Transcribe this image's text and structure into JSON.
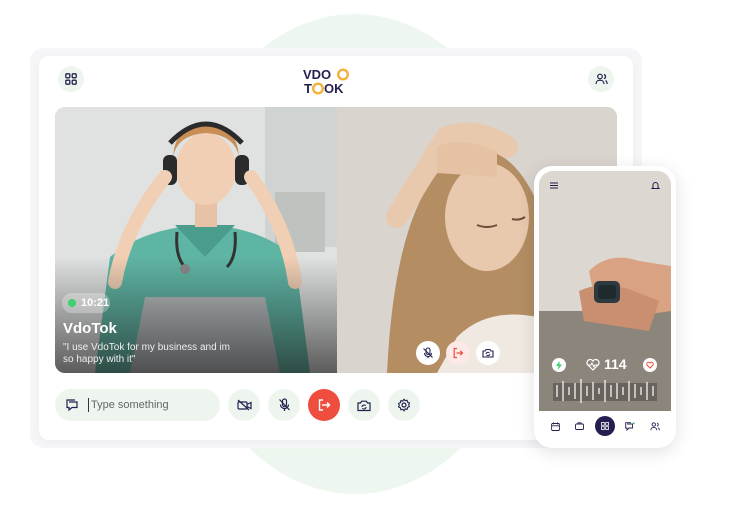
{
  "brand": {
    "line1": "VDO",
    "line2": "TOK",
    "colors": {
      "navy": "#241f4f",
      "gold": "#f3b23a",
      "accent_red": "#ef4d3d",
      "mint": "#eef5ee"
    }
  },
  "header": {
    "grid_icon": "grid-icon",
    "users_icon": "users-icon"
  },
  "call": {
    "timer": "10:21",
    "caller_name": "VdoTok",
    "caller_quote": "\"I use VdoTok for my business and im so happy with it\""
  },
  "chat": {
    "placeholder": "Type something",
    "icon": "chat-icon"
  },
  "controls": [
    "camera-off-icon",
    "mic-off-icon",
    "leave-call-icon",
    "camera-flip-icon",
    "settings-icon"
  ],
  "phone": {
    "heart_rate": "114",
    "nav": [
      "calendar-icon",
      "briefcase-icon",
      "grid-icon",
      "chat-icon",
      "users-icon"
    ]
  }
}
